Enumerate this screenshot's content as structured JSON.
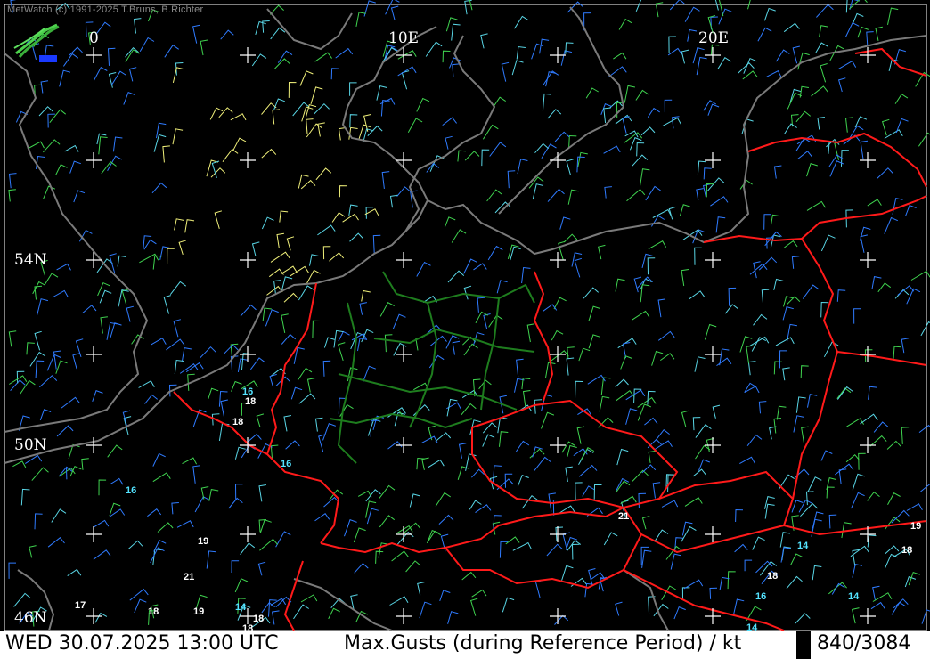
{
  "credit": "MetWatch  (c) 1991-2025 T.Bruns, B.Richter",
  "longitude_labels": [
    "0",
    "10E",
    "20E"
  ],
  "latitude_labels": [
    "54N",
    "50N",
    "46N"
  ],
  "gust_values": [
    {
      "value": "16",
      "color": "cyan"
    },
    {
      "value": "18",
      "color": "white"
    },
    {
      "value": "18",
      "color": "white"
    },
    {
      "value": "16",
      "color": "cyan"
    },
    {
      "value": "16",
      "color": "cyan"
    },
    {
      "value": "19",
      "color": "white"
    },
    {
      "value": "21",
      "color": "white"
    },
    {
      "value": "17",
      "color": "white"
    },
    {
      "value": "18",
      "color": "white"
    },
    {
      "value": "19",
      "color": "white"
    },
    {
      "value": "14",
      "color": "cyan"
    },
    {
      "value": "18",
      "color": "white"
    },
    {
      "value": "18",
      "color": "white"
    },
    {
      "value": "21",
      "color": "white"
    },
    {
      "value": "14",
      "color": "cyan"
    },
    {
      "value": "18",
      "color": "white"
    },
    {
      "value": "16",
      "color": "cyan"
    },
    {
      "value": "14",
      "color": "cyan"
    },
    {
      "value": "14",
      "color": "cyan"
    },
    {
      "value": "19",
      "color": "white"
    },
    {
      "value": "18",
      "color": "white"
    }
  ],
  "status_bar": {
    "datetime": "WED 30.07.2025 13:00 UTC",
    "product": "Max.Gusts (during Reference Period) / kt",
    "counter": "840/3084"
  },
  "colors": {
    "coastline": "#7a7a7a",
    "country_border": "#ff1a1a",
    "state_border": "#1e7d1e",
    "wind_barb_low": "#2f7bff",
    "wind_barb_mid": "#3fd34f",
    "wind_barb_cyan": "#59d6e6",
    "wind_barb_high": "#f0f07a",
    "gust_label_cyan": "#54e3ff",
    "gust_label_white": "#ffffff"
  }
}
